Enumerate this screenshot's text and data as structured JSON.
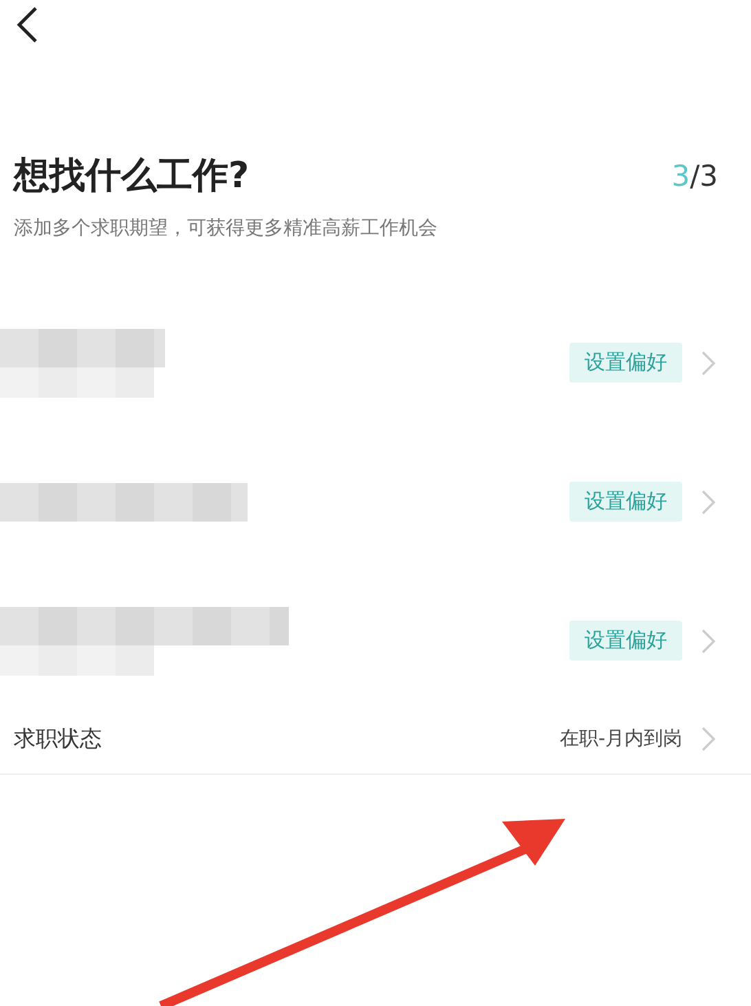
{
  "title": "想找什么工作?",
  "progress": {
    "current": "3",
    "total": "/3"
  },
  "subtitle": "添加多个求职期望，可获得更多精准高薪工作机会",
  "expectations": [
    {
      "button": "设置偏好"
    },
    {
      "button": "设置偏好"
    },
    {
      "button": "设置偏好"
    }
  ],
  "status": {
    "label": "求职状态",
    "value": "在职-月内到岗"
  }
}
